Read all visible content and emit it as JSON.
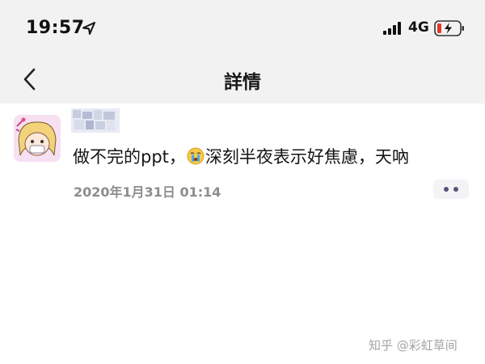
{
  "status_bar": {
    "time": "19:57",
    "location_icon": "location-arrow-icon",
    "signal_icon": "cellular-signal-icon",
    "network": "4G",
    "battery_icon": "battery-low-charging-icon",
    "battery_color": "#e0392f"
  },
  "nav": {
    "back_icon": "chevron-left-icon",
    "title": "詳情"
  },
  "post": {
    "avatar_icon": "avatar-cartoon",
    "username_hidden": true,
    "text_before_emoji": "做不完的ppt，",
    "emoji_icon": "crying-face-emoji-icon",
    "text_after_emoji": "深刻半夜表示好焦慮，天吶",
    "timestamp": "2020年1月31日 01:14",
    "more_icon": "more-dots-icon",
    "more_color": "#55557a"
  },
  "watermark": {
    "text": "知乎 @彩虹草间"
  }
}
